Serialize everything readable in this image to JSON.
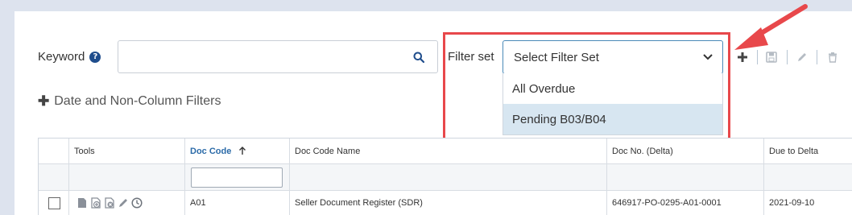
{
  "search": {
    "keyword_label": "Keyword",
    "help_icon": "question-circle-icon",
    "keyword_value": "",
    "search_icon": "search-icon"
  },
  "filter_set": {
    "label": "Filter set",
    "placeholder": "Select Filter Set",
    "options": [
      "All Overdue",
      "Pending B03/B04"
    ],
    "highlighted_option": "Pending B03/B04",
    "toolbar_icons": [
      "plus-icon",
      "save-icon",
      "pencil-icon",
      "trash-icon"
    ]
  },
  "annotation": {
    "color": "#e8484b"
  },
  "filters_toggle": {
    "icon": "plus-icon",
    "label": "Date and Non-Column Filters"
  },
  "table": {
    "columns": [
      "",
      "Tools",
      "Doc Code",
      "Doc Code Name",
      "Doc No. (Delta)",
      "Due to Delta"
    ],
    "sorted_column": "Doc Code",
    "sort_direction": "ascending",
    "rows": [
      {
        "tool_icons": [
          "document-icon",
          "document-add-icon",
          "document-remove-icon",
          "pencil-icon",
          "clock-icon"
        ],
        "doc_code": "A01",
        "doc_code_name": "Seller Document Register (SDR)",
        "doc_no": "646917-PO-0295-A01-0001",
        "due_to_delta": "2021-09-10"
      }
    ]
  },
  "colors": {
    "page_bg": "#dde3ee",
    "accent": "#2a6aa8",
    "select_border": "#4a8ab8",
    "option_highlight": "#d7e6f1"
  }
}
